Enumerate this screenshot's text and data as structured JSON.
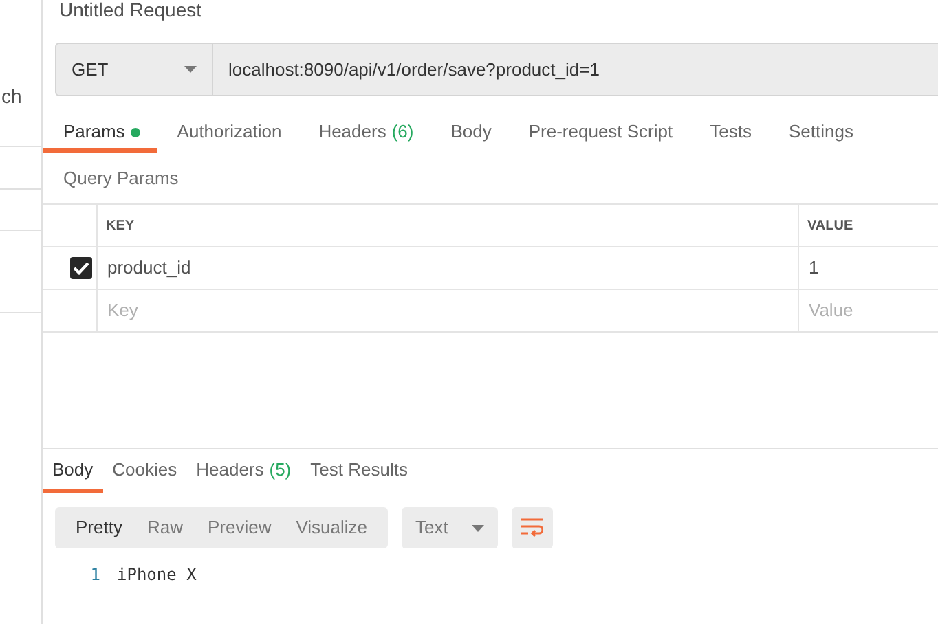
{
  "sidebar": {
    "fragment": "ch"
  },
  "request": {
    "title": "Untitled Request",
    "method": "GET",
    "url": "localhost:8090/api/v1/order/save?product_id=1"
  },
  "request_tabs": [
    {
      "label": "Params",
      "dot": true,
      "selected": true
    },
    {
      "label": "Authorization",
      "dot": false,
      "selected": false
    },
    {
      "label": "Headers",
      "count": "(6)",
      "dot": false,
      "selected": false
    },
    {
      "label": "Body",
      "dot": false,
      "selected": false
    },
    {
      "label": "Pre-request Script",
      "dot": false,
      "selected": false
    },
    {
      "label": "Tests",
      "dot": false,
      "selected": false
    },
    {
      "label": "Settings",
      "dot": false,
      "selected": false
    }
  ],
  "query_params": {
    "title": "Query Params",
    "columns": [
      "KEY",
      "VALUE"
    ],
    "rows": [
      {
        "key": "product_id",
        "value": "1",
        "checked": true
      }
    ],
    "new_row": {
      "key": {
        "placeholder": "Key"
      },
      "value": {
        "placeholder": "Value"
      }
    }
  },
  "response_tabs": [
    {
      "label": "Body",
      "selected": true
    },
    {
      "label": "Cookies",
      "selected": false
    },
    {
      "label": "Headers",
      "count": "(5)",
      "selected": false
    },
    {
      "label": "Test Results",
      "selected": false
    }
  ],
  "formats": [
    {
      "label": "Pretty",
      "selected": true
    },
    {
      "label": "Raw",
      "selected": false
    },
    {
      "label": "Preview",
      "selected": false
    },
    {
      "label": "Visualize",
      "selected": false
    }
  ],
  "content_type": "Text",
  "code_lines": [
    {
      "number": "1",
      "text": "iPhone X"
    }
  ]
}
